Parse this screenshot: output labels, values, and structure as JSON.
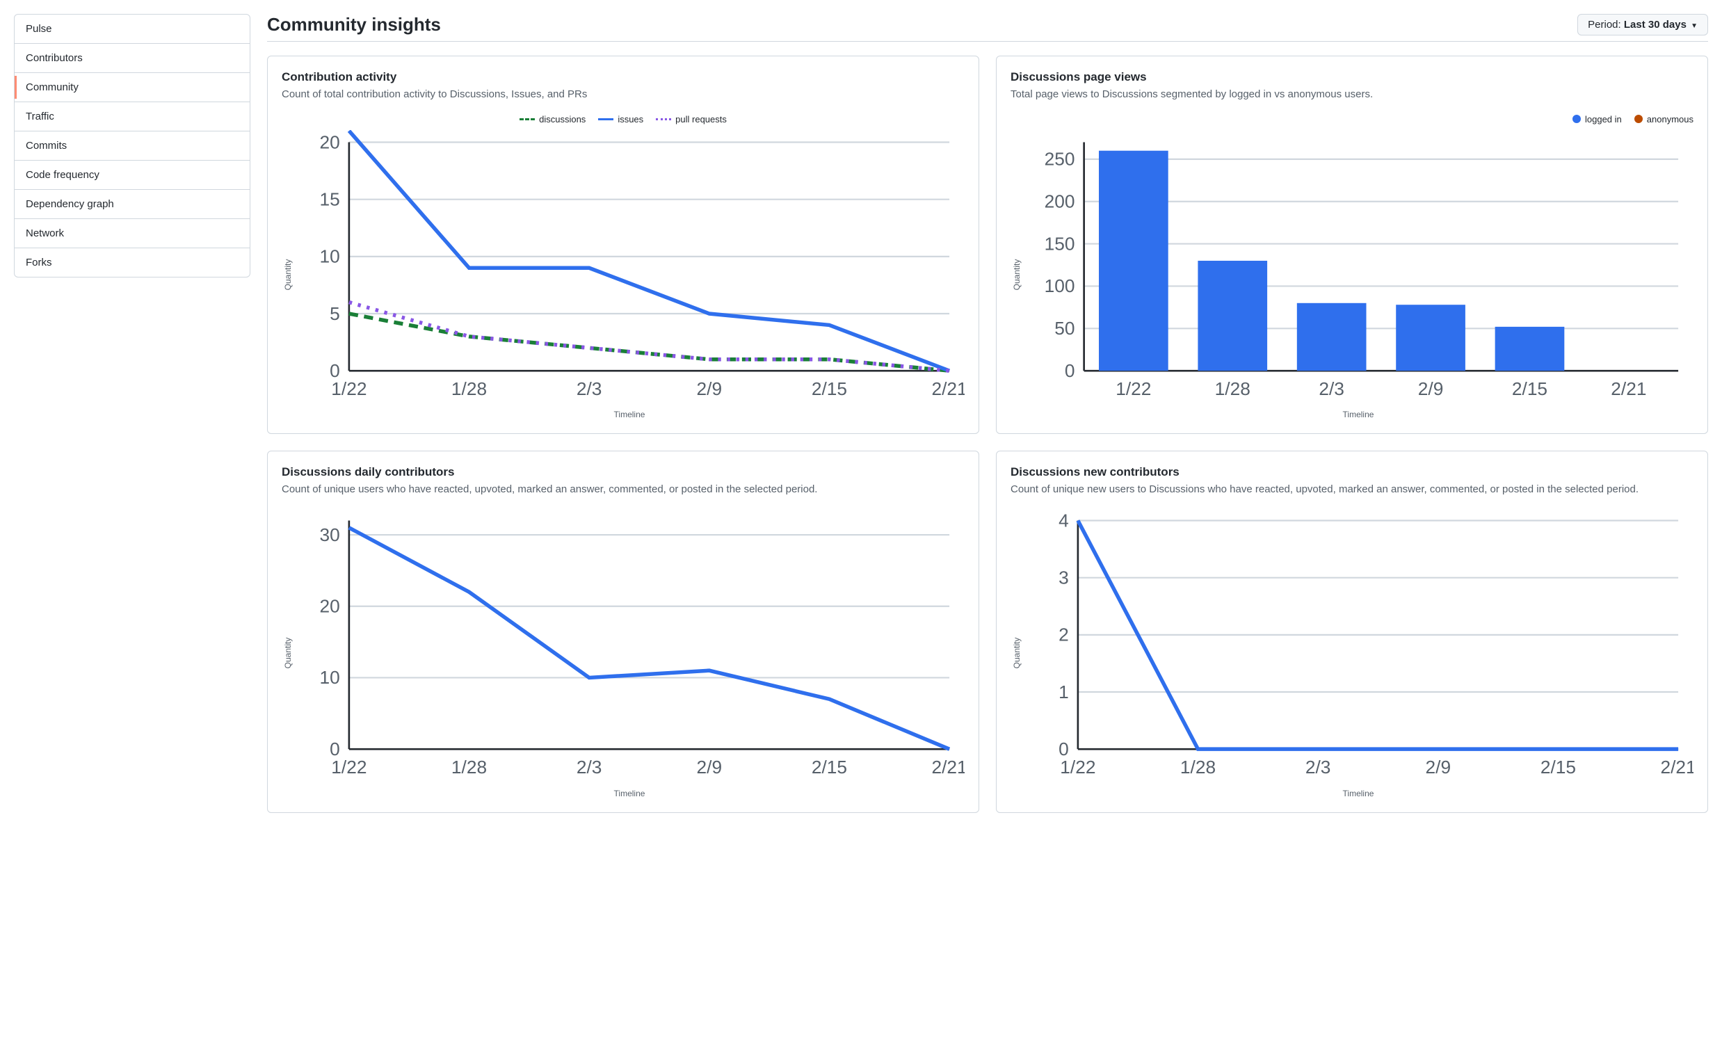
{
  "sidebar": {
    "items": [
      {
        "label": "Pulse"
      },
      {
        "label": "Contributors"
      },
      {
        "label": "Community"
      },
      {
        "label": "Traffic"
      },
      {
        "label": "Commits"
      },
      {
        "label": "Code frequency"
      },
      {
        "label": "Dependency graph"
      },
      {
        "label": "Network"
      },
      {
        "label": "Forks"
      }
    ],
    "active_index": 2
  },
  "header": {
    "title": "Community insights",
    "period_label": "Period: ",
    "period_value": "Last 30 days"
  },
  "cards": {
    "contrib": {
      "title": "Contribution activity",
      "desc": "Count of total contribution activity to Discussions, Issues, and PRs"
    },
    "views": {
      "title": "Discussions page views",
      "desc": "Total page views to Discussions segmented by logged in vs anonymous users."
    },
    "daily": {
      "title": "Discussions daily contributors",
      "desc": "Count of unique users who have reacted, upvoted, marked an answer, commented, or posted in the selected period."
    },
    "newc": {
      "title": "Discussions new contributors",
      "desc": "Count of unique new users to Discussions who have reacted, upvoted, marked an answer, commented, or posted in the selected period."
    }
  },
  "labels": {
    "quantity": "Quantity",
    "timeline": "Timeline"
  },
  "legends": {
    "contrib": {
      "discussions": "discussions",
      "issues": "issues",
      "pull_requests": "pull requests"
    },
    "views": {
      "logged_in": "logged in",
      "anonymous": "anonymous"
    }
  },
  "colors": {
    "issues": "#2f6fed",
    "discussions": "#1a7f37",
    "pull_requests": "#8957e5",
    "logged_in": "#2f6fed",
    "anonymous": "#bc4c00",
    "line_blue": "#2f6fed"
  },
  "chart_data": [
    {
      "id": "contribution_activity",
      "type": "line",
      "title": "Contribution activity",
      "xlabel": "Timeline",
      "ylabel": "Quantity",
      "categories": [
        "1/22",
        "1/28",
        "2/3",
        "2/9",
        "2/15",
        "2/21"
      ],
      "ylim": [
        0,
        20
      ],
      "yticks": [
        0,
        5,
        10,
        15,
        20
      ],
      "series": [
        {
          "name": "discussions",
          "color": "#1a7f37",
          "dash": "6,4",
          "values": [
            5,
            3,
            2,
            1,
            1,
            0
          ]
        },
        {
          "name": "issues",
          "color": "#2f6fed",
          "dash": "",
          "values": [
            21,
            9,
            9,
            5,
            4,
            0
          ]
        },
        {
          "name": "pull requests",
          "color": "#8957e5",
          "dash": "2,4",
          "values": [
            6,
            3,
            2,
            1,
            1,
            0
          ]
        }
      ]
    },
    {
      "id": "discussions_page_views",
      "type": "bar",
      "title": "Discussions page views",
      "xlabel": "Timeline",
      "ylabel": "Quantity",
      "categories": [
        "1/22",
        "1/28",
        "2/3",
        "2/9",
        "2/15",
        "2/21"
      ],
      "ylim": [
        0,
        270
      ],
      "yticks": [
        0,
        50,
        100,
        150,
        200,
        250
      ],
      "series": [
        {
          "name": "logged in",
          "color": "#2f6fed",
          "values": [
            260,
            130,
            80,
            78,
            52,
            0
          ]
        },
        {
          "name": "anonymous",
          "color": "#bc4c00",
          "values": [
            0,
            0,
            0,
            0,
            0,
            0
          ]
        }
      ]
    },
    {
      "id": "discussions_daily_contributors",
      "type": "line",
      "title": "Discussions daily contributors",
      "xlabel": "Timeline",
      "ylabel": "Quantity",
      "categories": [
        "1/22",
        "1/28",
        "2/3",
        "2/9",
        "2/15",
        "2/21"
      ],
      "ylim": [
        0,
        32
      ],
      "yticks": [
        0,
        10,
        20,
        30
      ],
      "series": [
        {
          "name": "contributors",
          "color": "#2f6fed",
          "values": [
            31,
            22,
            10,
            11,
            7,
            0
          ]
        }
      ]
    },
    {
      "id": "discussions_new_contributors",
      "type": "line",
      "title": "Discussions new contributors",
      "xlabel": "Timeline",
      "ylabel": "Quantity",
      "categories": [
        "1/22",
        "1/28",
        "2/3",
        "2/9",
        "2/15",
        "2/21"
      ],
      "ylim": [
        0,
        4
      ],
      "yticks": [
        0,
        1,
        2,
        3,
        4
      ],
      "series": [
        {
          "name": "new contributors",
          "color": "#2f6fed",
          "values": [
            4,
            0,
            0,
            0,
            0,
            0
          ]
        }
      ]
    }
  ]
}
